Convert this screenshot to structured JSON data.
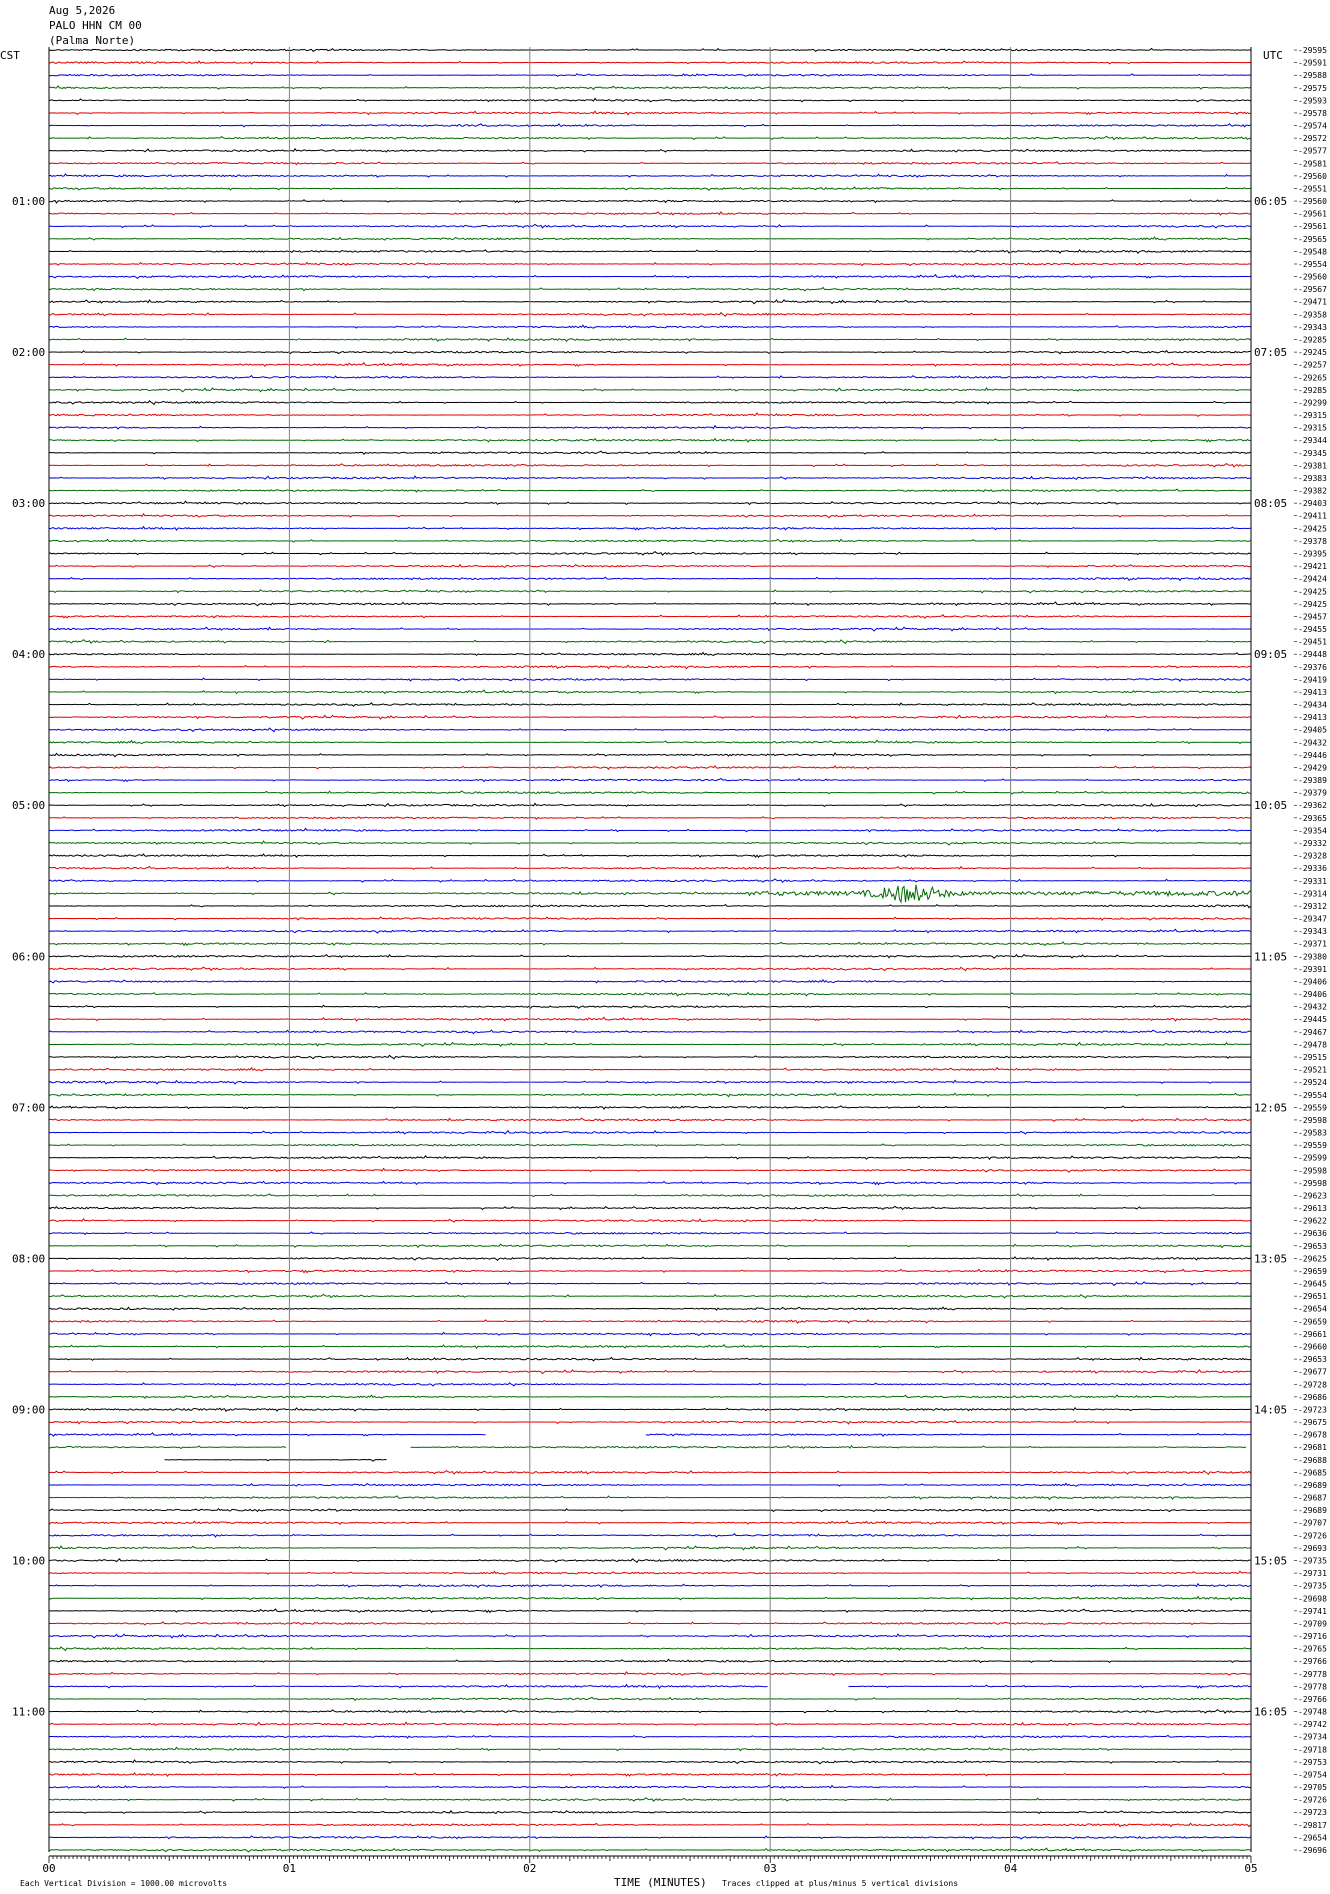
{
  "header": {
    "date": "Aug 5,2026",
    "station": "PALO HHN CM 00",
    "location": "(Palma Norte)"
  },
  "left_tz": "CST",
  "right_tz": "UTC",
  "footer": {
    "scale_note": "Each Vertical Division = 1000.00 microvolts",
    "xlabel": "TIME (MINUTES)",
    "clip_note": "Traces clipped at plus/minus 5 vertical divisions"
  },
  "colors": {
    "trace_cycle": [
      "#000000",
      "#e00000",
      "#0000e0",
      "#006a00"
    ],
    "grid": "#808080",
    "axis": "#000000"
  },
  "chart_data": {
    "type": "line",
    "xlabel": "TIME (MINUTES)",
    "x_ticks": [
      "00",
      "01",
      "02",
      "03",
      "04",
      "05"
    ],
    "xlim": [
      0,
      5
    ],
    "n_traces": 144,
    "trace_minutes": 5,
    "left_hour_labels": [
      "01:00",
      "02:00",
      "03:00",
      "04:00",
      "05:00",
      "06:00",
      "07:00",
      "08:00",
      "09:00",
      "10:00",
      "11:00"
    ],
    "right_hour_labels": [
      "06:05",
      "07:05",
      "08:05",
      "09:05",
      "10:05",
      "11:05",
      "12:05",
      "13:05",
      "14:05",
      "15:05",
      "16:05"
    ],
    "hour_label_first_trace": 12,
    "hour_label_every": 12,
    "trace_offsets": [
      "-29595",
      "-29591",
      "-29588",
      "-29575",
      "-29593",
      "-29578",
      "-29574",
      "-29572",
      "-29577",
      "-29581",
      "-29560",
      "-29551",
      "-29560",
      "-29561",
      "-29561",
      "-29565",
      "-29548",
      "-29554",
      "-29560",
      "-29567",
      "-29471",
      "-29358",
      "-29343",
      "-29285",
      "-29245",
      "-29257",
      "-29265",
      "-29285",
      "-29299",
      "-29315",
      "-29315",
      "-29344",
      "-29345",
      "-29381",
      "-29383",
      "-29382",
      "-29403",
      "-29411",
      "-29425",
      "-29378",
      "-29395",
      "-29421",
      "-29424",
      "-29425",
      "-29425",
      "-29457",
      "-29455",
      "-29451",
      "-29448",
      "-29376",
      "-29419",
      "-29413",
      "-29434",
      "-29413",
      "-29405",
      "-29432",
      "-29446",
      "-29429",
      "-29389",
      "-29379",
      "-29362",
      "-29365",
      "-29354",
      "-29332",
      "-29328",
      "-29336",
      "-29331",
      "-29314",
      "-29312",
      "-29347",
      "-29343",
      "-29371",
      "-29380",
      "-29391",
      "-29406",
      "-29406",
      "-29432",
      "-29445",
      "-29467",
      "-29478",
      "-29515",
      "-29521",
      "-29524",
      "-29554",
      "-29559",
      "-29598",
      "-29583",
      "-29559",
      "-29599",
      "-29598",
      "-29598",
      "-29623",
      "-29613",
      "-29622",
      "-29636",
      "-29653",
      "-29625",
      "-29659",
      "-29645",
      "-29651",
      "-29654",
      "-29659",
      "-29661",
      "-29660",
      "-29653",
      "-29677",
      "-29728",
      "-29686",
      "-29723",
      "-29675",
      "-29678",
      "-29681",
      "-29688",
      "-29685",
      "-29689",
      "-29687",
      "-29689",
      "-29707",
      "-29726",
      "-29693",
      "-29735",
      "-29731",
      "-29735",
      "-29698",
      "-29741",
      "-29709",
      "-29716",
      "-29765",
      "-29766",
      "-29778",
      "-29778",
      "-29766",
      "-29748",
      "-29742",
      "-29734",
      "-29718",
      "-29753",
      "-29754",
      "-29705",
      "-29726",
      "-29723",
      "-29817",
      "-29654",
      "-29696"
    ],
    "events": [
      {
        "trace": 67,
        "start_min": 2.9,
        "peak_min": 3.58,
        "end_min": 5.0,
        "label": ""
      }
    ],
    "gaps": [
      {
        "trace": 110,
        "from_min": 1.82,
        "to_min": 2.48
      },
      {
        "trace": 111,
        "from_min": 0.99,
        "to_min": 1.5
      },
      {
        "trace": 111,
        "from_min": 4.98,
        "to_min": 5.0
      },
      {
        "trace": 112,
        "from_min": 0.0,
        "to_min": 0.48
      },
      {
        "trace": 112,
        "from_min": 1.41,
        "to_min": 5.0
      },
      {
        "trace": 130,
        "from_min": 2.99,
        "to_min": 3.32
      }
    ]
  }
}
